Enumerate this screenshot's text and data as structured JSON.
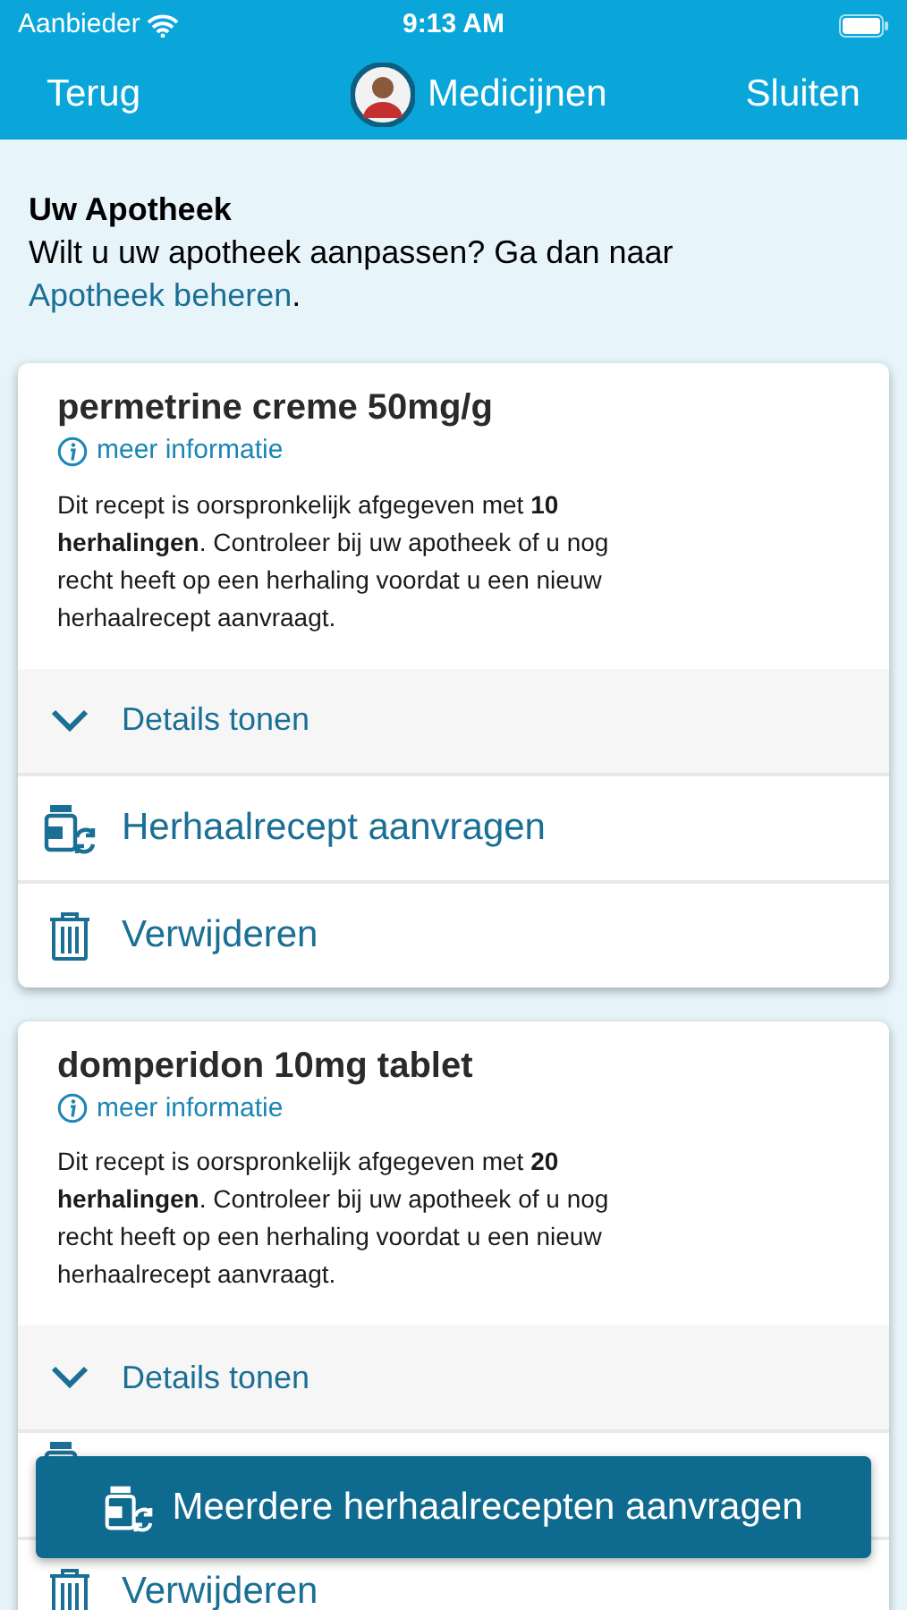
{
  "status_bar": {
    "carrier": "Aanbieder",
    "time": "9:13 AM"
  },
  "nav": {
    "back": "Terug",
    "title": "Medicijnen",
    "close": "Sluiten"
  },
  "pharmacy": {
    "title": "Uw Apotheek",
    "text": "Wilt u uw apotheek aanpassen? Ga dan naar",
    "link": "Apotheek beheren",
    "after": "."
  },
  "prescriptions": [
    {
      "name": "permetrine creme 50mg/g",
      "info": "meer informatie",
      "description": "Dit recept is oorspronkelijk afgegeven met **10 herhalingen**. Controleer bij uw apotheek of u nog recht heeft op een herhaling voordat u een nieuw herhaalrecept aanvraagt.",
      "actions": [
        {
          "kind": "details",
          "label": "Details tonen"
        },
        {
          "kind": "request",
          "label": "Herhaalrecept aanvragen"
        },
        {
          "kind": "delete",
          "label": "Verwijderen"
        }
      ]
    },
    {
      "name": "domperidon 10mg tablet",
      "info": "meer informatie",
      "description": "Dit recept is oorspronkelijk afgegeven met **20 herhalingen**. Controleer bij uw apotheek of u nog recht heeft op een herhaling voordat u een nieuw herhaalrecept aanvraagt.",
      "actions": [
        {
          "kind": "details",
          "label": "Details tonen"
        },
        {
          "kind": "request"
        },
        {
          "kind": "delete",
          "label": "Verwijderen"
        }
      ]
    }
  ],
  "floating_button": {
    "label": "Meerdere herhaalrecepten aanvragen"
  }
}
